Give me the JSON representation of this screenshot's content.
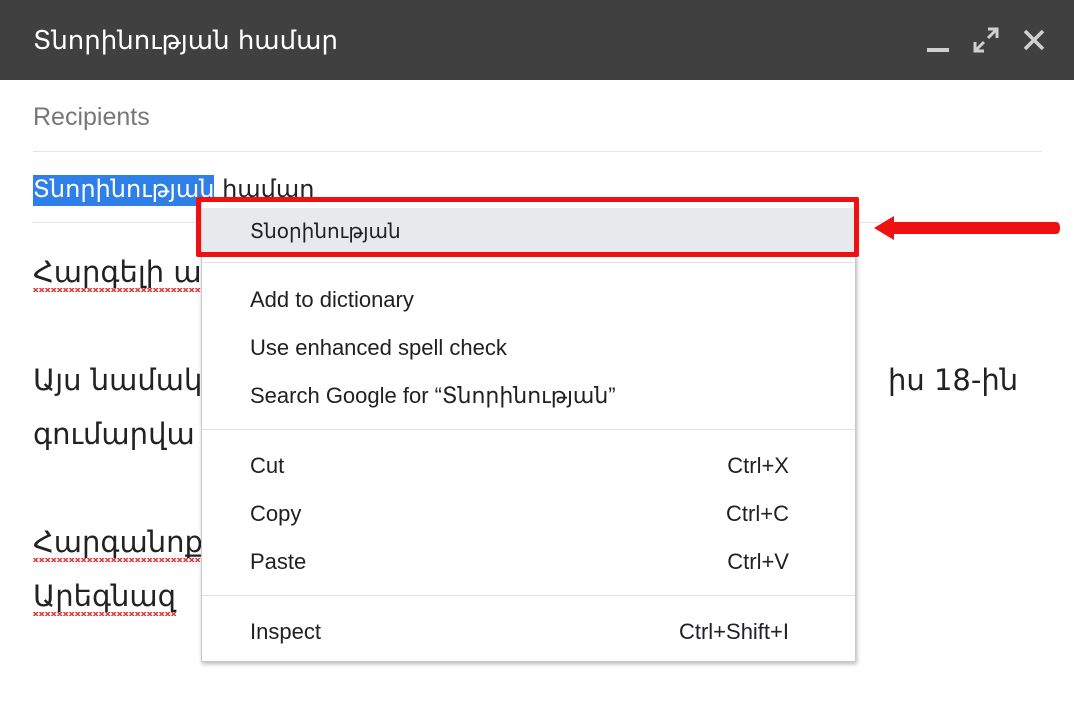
{
  "window": {
    "title": "Տնորինության համար",
    "minimize_icon": "minimize-icon",
    "expand_icon": "expand-icon",
    "close_icon": "close-icon"
  },
  "compose": {
    "recipients_placeholder": "Recipients",
    "subject": {
      "selected": "Տնորինության",
      "rest": " համար"
    },
    "body": {
      "line1": "Հարգելի ա",
      "line2_start": "Այս նամակ",
      "line2_end": "իս 18-ին",
      "line3": "գումարվա",
      "line4": "Հարգանոք",
      "line5": "Արեգնազ"
    }
  },
  "context_menu": {
    "suggestion": "Տնօրինության",
    "add_to_dictionary": "Add to dictionary",
    "enhanced_spell_check": "Use enhanced spell check",
    "search_google": "Search Google for “Տնորինության”",
    "cut": {
      "label": "Cut",
      "shortcut": "Ctrl+X"
    },
    "copy": {
      "label": "Copy",
      "shortcut": "Ctrl+C"
    },
    "paste": {
      "label": "Paste",
      "shortcut": "Ctrl+V"
    },
    "inspect": {
      "label": "Inspect",
      "shortcut": "Ctrl+Shift+I"
    }
  },
  "annotation": {
    "highlight_color": "#ee1111",
    "arrow_icon": "left-arrow-icon"
  }
}
